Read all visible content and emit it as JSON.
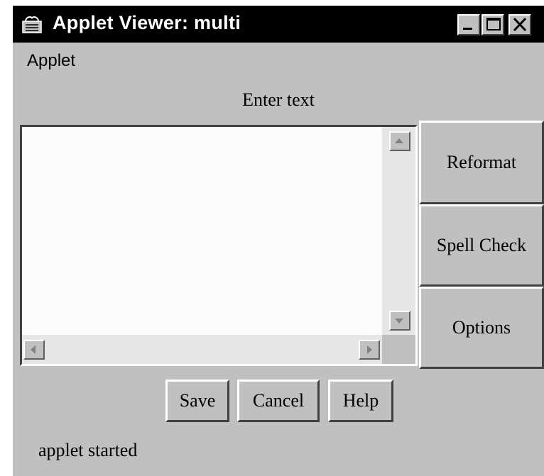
{
  "window": {
    "title": "Applet Viewer: multi",
    "title_icon": "java-applet-icon",
    "controls": {
      "minimize_icon": "minimize-icon",
      "maximize_icon": "maximize-icon",
      "close_icon": "close-icon"
    }
  },
  "menubar": {
    "items": [
      {
        "label": "Applet"
      }
    ]
  },
  "main": {
    "prompt_label": "Enter text",
    "textarea": {
      "value": ""
    },
    "side_buttons": [
      {
        "label": "Reformat"
      },
      {
        "label": "Spell Check"
      },
      {
        "label": "Options"
      }
    ],
    "bottom_buttons": [
      {
        "label": "Save"
      },
      {
        "label": "Cancel"
      },
      {
        "label": "Help"
      }
    ]
  },
  "status": {
    "text": "applet started"
  },
  "colors": {
    "titlebar_bg": "#000000",
    "window_bg": "#c0c0c0",
    "textarea_bg": "#fbfbfb"
  }
}
